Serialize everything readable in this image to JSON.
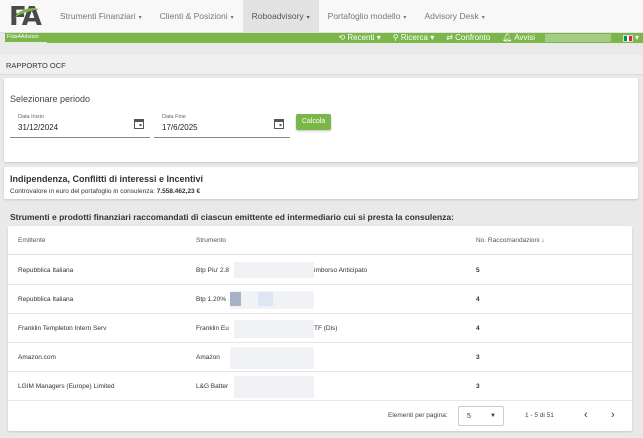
{
  "brand": {
    "logo_text": "FA",
    "tagline": "Fida4Advisor",
    "accent": "#7ab648"
  },
  "nav": [
    {
      "label": "Strumenti Finanziari",
      "active": false
    },
    {
      "label": "Clienti & Posizioni",
      "active": false
    },
    {
      "label": "Roboadvisory",
      "active": true
    },
    {
      "label": "Portafoglio modello",
      "active": false
    },
    {
      "label": "Advisory Desk",
      "active": false
    }
  ],
  "subnav": {
    "recenti": "Recenti",
    "ricerca": "Ricerca",
    "confronto": "Confronto",
    "avvisi": "Avvisi"
  },
  "page_title": "RAPPORTO OCF",
  "period": {
    "title": "Selezionare periodo",
    "start_label": "Data Inizio",
    "start_value": "31/12/2024",
    "end_label": "Data Fine",
    "end_value": "17/6/2025",
    "button": "Calcola"
  },
  "independence": {
    "heading": "Indipendenza, Conflitti di interessi e Incentivi",
    "text_prefix": "Controvalore in euro del portafoglio in consulenza:",
    "amount": "7.558.462,23 €"
  },
  "section_title": "Strumenti e prodotti finanziari raccomandati di ciascun emittente ed intermediario cui si presta la consulenza:",
  "table": {
    "headers": {
      "emittente": "Emittente",
      "strumento": "Strumento",
      "raccomandazioni": "No. Raccomandazioni"
    },
    "rows": [
      {
        "emittente": "Repubblica Italiana",
        "strumento_a": "Btp Piu' 2.8",
        "strumento_b": "imborso Anticipato",
        "count": "5"
      },
      {
        "emittente": "Repubblica Italiana",
        "strumento_a": "Btp 1.20%",
        "strumento_b": "",
        "count": "4"
      },
      {
        "emittente": "Franklin Templeton Intern Serv",
        "strumento_a": "Franklin Eu",
        "strumento_b": "TF (Dis)",
        "count": "4"
      },
      {
        "emittente": "Amazon.com",
        "strumento_a": "Amazon",
        "strumento_b": "",
        "count": "3"
      },
      {
        "emittente": "LGIM Managers (Europe) Limited",
        "strumento_a": "L&G Batter",
        "strumento_b": "",
        "count": "3"
      }
    ]
  },
  "pager": {
    "label": "Elementi per pagina:",
    "page_size": "5",
    "range": "1 - 5 di 51"
  }
}
